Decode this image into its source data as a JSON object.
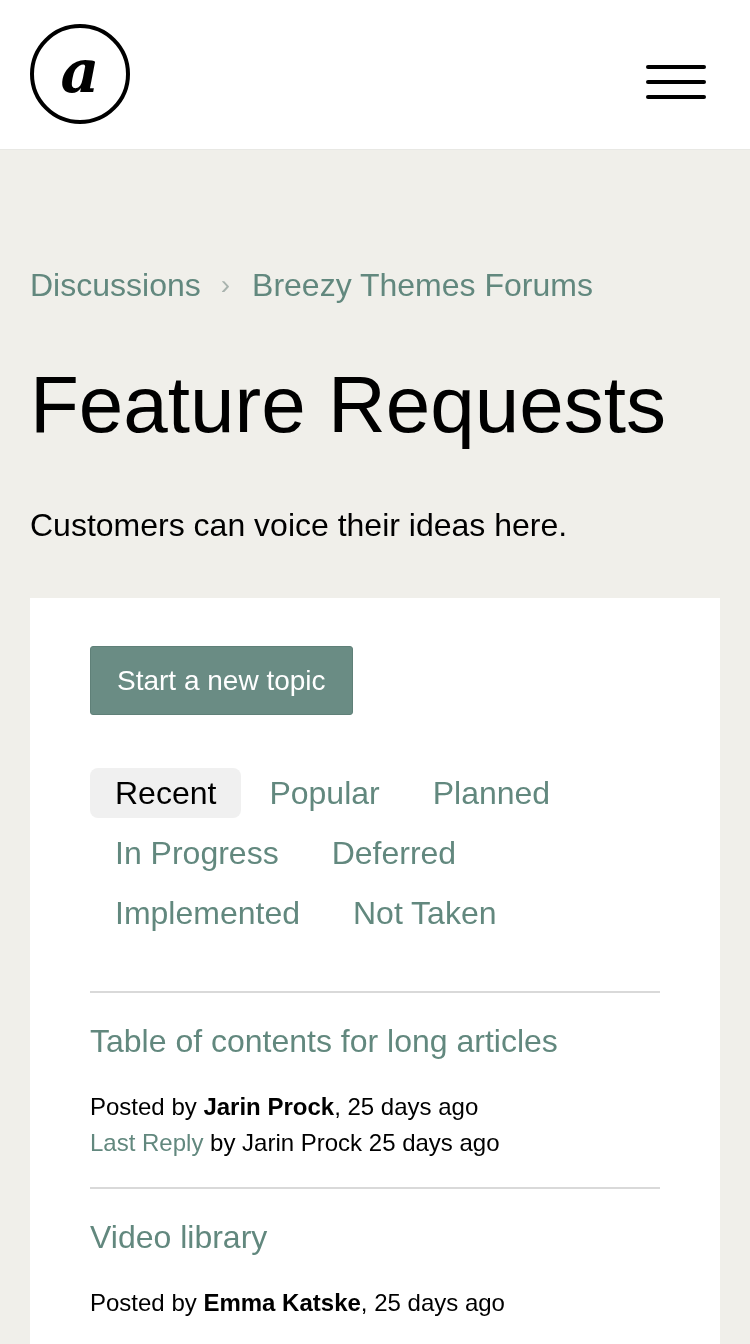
{
  "header": {
    "logo_text": "a"
  },
  "breadcrumbs": {
    "items": [
      {
        "label": "Discussions"
      },
      {
        "label": "Breezy Themes Forums"
      }
    ],
    "separator": "›"
  },
  "page": {
    "title": "Feature Requests",
    "description": "Customers can voice their ideas here."
  },
  "topics_panel": {
    "new_topic_button": "Start a new topic",
    "tabs": [
      {
        "label": "Recent",
        "selected": true
      },
      {
        "label": "Popular",
        "selected": false
      },
      {
        "label": "Planned",
        "selected": false
      },
      {
        "label": "In Progress",
        "selected": false
      },
      {
        "label": "Deferred",
        "selected": false
      },
      {
        "label": "Implemented",
        "selected": false
      },
      {
        "label": "Not Taken",
        "selected": false
      }
    ],
    "topics": [
      {
        "title": "Table of contents for long articles",
        "posted": "Posted by **Jarin Prock**, 25 days ago",
        "last_reply": {
          "link": "Last Reply",
          "text": "by Jarin Prock 25 days ago"
        }
      },
      {
        "title": "Video library",
        "posted": "Posted by **Emma Katske**, 25 days ago"
      }
    ]
  }
}
